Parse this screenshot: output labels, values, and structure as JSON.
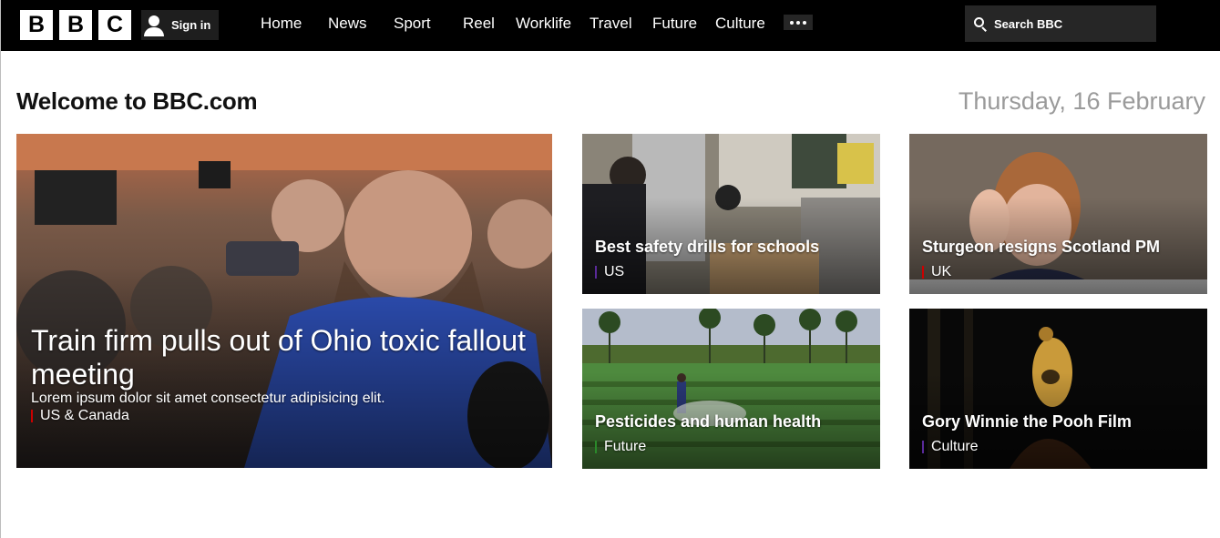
{
  "header": {
    "logo_letters": [
      "B",
      "B",
      "C"
    ],
    "sign_in_label": "Sign in",
    "nav": [
      "Home",
      "News",
      "Sport",
      "Reel",
      "Worklife",
      "Travel",
      "Future",
      "Culture"
    ],
    "search_placeholder": "Search BBC"
  },
  "main": {
    "welcome_title": "Welcome to BBC.com",
    "date": "Thursday, 16 February"
  },
  "hero": {
    "headline": "Train firm pulls out of Ohio toxic fallout meeting",
    "summary": "Lorem ipsum dolor sit amet consectetur adipisicing elit.",
    "tag": "US & Canada"
  },
  "cards": [
    {
      "headline": "Best safety drills for schools",
      "tag": "US"
    },
    {
      "headline": "Sturgeon resigns Scotland PM",
      "tag": "UK"
    },
    {
      "headline": "Pesticides and human health",
      "tag": "Future"
    },
    {
      "headline": "Gory Winnie the Pooh Film",
      "tag": "Culture"
    }
  ],
  "colors": {
    "nav_background": "#000000",
    "tag_marker_red": "#cc0000",
    "tag_marker_purple": "#5a2a9a",
    "tag_marker_green": "#2a8a2a",
    "date_grey": "#9a9a9a"
  },
  "icons": [
    "user-icon",
    "more-dots-icon",
    "search-icon"
  ]
}
